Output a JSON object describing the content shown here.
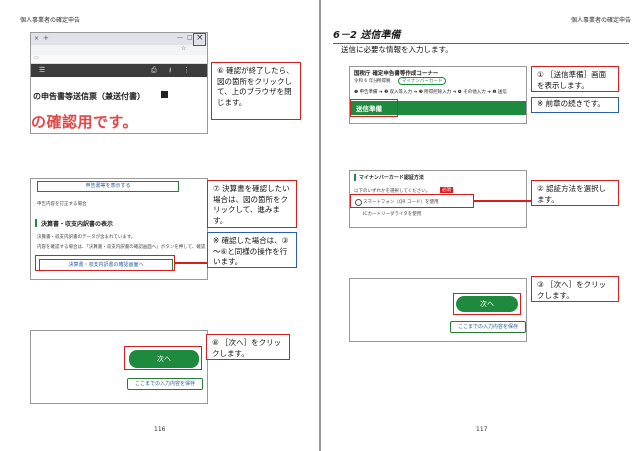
{
  "header": {
    "left": "個人事業者の確定申告",
    "right": "個人事業者の確定申告"
  },
  "left_page": {
    "page_number": "116",
    "shot1": {
      "close_symbol": "×",
      "doc_heading": "の申告書等送信票（兼送付書）",
      "watermark": "の確認用です。"
    },
    "callout6": "⑥ 確認が終了したら、図の箇所をクリックして、上のブラウザを閉じます。",
    "shot2": {
      "print_btn": "申告書等を表示する",
      "line1": "申告内容を訂正する場合",
      "section": "決算書・収支内訳書の表示",
      "line2": "決算書・収支内訳書のデータが含まれています。",
      "line3": "内容を確認する場合は、「決算書・収支内訳書の確認画面へ」ボタンを押して、確認",
      "btn": "決算書・収支内訳書の確認画面へ"
    },
    "callout7": "⑦ 決算書を確認したい場合は、図の箇所をクリックして、進みます。",
    "note7": "※ 確認した場合は、③～⑥と同様の操作を行います。",
    "shot3": {
      "next": "次へ",
      "save": "ここまでの入力内容を保存"
    },
    "callout8": "⑧ ［次へ］をクリックします。"
  },
  "right_page": {
    "page_number": "117",
    "section_title": "6－2 送信準備",
    "subtitle": "送信に必要な情報を入力します。",
    "shot4": {
      "corner": "国税庁 確定申告書等作成コーナー",
      "year": "令和 6 年分",
      "tag1": "所得税",
      "tag2": "マイナンバーカード",
      "steps": "❶ 申告準備 ➔ ❷ 収入等入力 ➔ ❸ 所得控除入力 ➔ ❹ その他入力 ➔ ❺ 送信",
      "bar": "送信準備"
    },
    "callout1": "① ［送信準備］画面を表示します。",
    "note1": "※ 前章の続きです。",
    "shot5": {
      "heading": "マイナンバーカード認証方法",
      "instr": "以下のいずれかを選択してください。",
      "required": "必須",
      "opt1": "スマートフォン（QR コード）を使用",
      "opt2": "ICカードリーダライタを使用"
    },
    "callout2": "② 認証方法を選択します。",
    "shot6": {
      "next": "次へ",
      "save": "ここまでの入力内容を保存"
    },
    "callout3": "③ ［次へ］をクリックします。"
  }
}
